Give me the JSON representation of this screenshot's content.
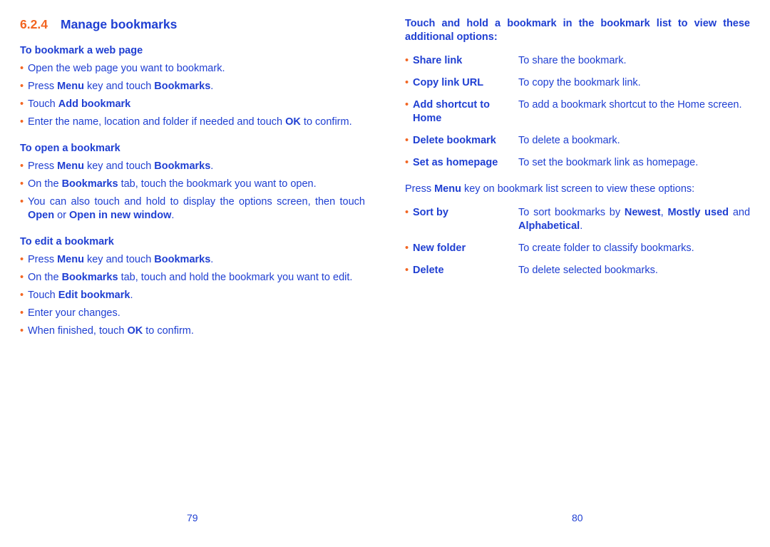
{
  "left": {
    "section_number": "6.2.4",
    "section_title": "Manage bookmarks",
    "sections": [
      {
        "heading": "To bookmark a web page",
        "bullets": [
          [
            {
              "t": "Open the web page you want to bookmark."
            }
          ],
          [
            {
              "t": "Press "
            },
            {
              "t": "Menu",
              "b": true
            },
            {
              "t": " key and touch "
            },
            {
              "t": "Bookmarks",
              "b": true
            },
            {
              "t": "."
            }
          ],
          [
            {
              "t": "Touch "
            },
            {
              "t": "Add bookmark",
              "b": true
            }
          ],
          [
            {
              "t": "Enter the name, location and folder if needed and touch "
            },
            {
              "t": "OK",
              "b": true
            },
            {
              "t": " to confirm."
            }
          ]
        ]
      },
      {
        "heading": "To open a bookmark",
        "bullets": [
          [
            {
              "t": "Press "
            },
            {
              "t": "Menu",
              "b": true
            },
            {
              "t": " key and touch "
            },
            {
              "t": "Bookmarks",
              "b": true
            },
            {
              "t": "."
            }
          ],
          [
            {
              "t": "On the "
            },
            {
              "t": "Bookmarks",
              "b": true
            },
            {
              "t": " tab, touch the bookmark you want to open."
            }
          ],
          [
            {
              "t": "You can also touch and hold to display the options screen, then touch "
            },
            {
              "t": "Open",
              "b": true
            },
            {
              "t": " or "
            },
            {
              "t": "Open in new window",
              "b": true
            },
            {
              "t": "."
            }
          ]
        ]
      },
      {
        "heading": "To edit a bookmark",
        "bullets": [
          [
            {
              "t": "Press "
            },
            {
              "t": "Menu",
              "b": true
            },
            {
              "t": " key and touch "
            },
            {
              "t": "Bookmarks",
              "b": true
            },
            {
              "t": "."
            }
          ],
          [
            {
              "t": "On the "
            },
            {
              "t": "Bookmarks",
              "b": true
            },
            {
              "t": " tab, touch and hold the bookmark you want to edit."
            }
          ],
          [
            {
              "t": "Touch "
            },
            {
              "t": "Edit bookmark",
              "b": true
            },
            {
              "t": "."
            }
          ],
          [
            {
              "t": "Enter your changes."
            }
          ],
          [
            {
              "t": "When finished, touch "
            },
            {
              "t": "OK",
              "b": true
            },
            {
              "t": " to confirm."
            }
          ]
        ]
      }
    ],
    "page_number": "79"
  },
  "right": {
    "intro": "Touch and hold a bookmark in the bookmark list to view these additional options:",
    "options": [
      {
        "key": "Share link",
        "desc": [
          {
            "t": "To share the bookmark."
          }
        ]
      },
      {
        "key": "Copy link URL",
        "desc": [
          {
            "t": "To copy the bookmark link."
          }
        ]
      },
      {
        "key": "Add shortcut to Home",
        "desc": [
          {
            "t": "To add a bookmark shortcut to the Home screen."
          }
        ]
      },
      {
        "key": "Delete bookmark",
        "desc": [
          {
            "t": "To delete a bookmark."
          }
        ]
      },
      {
        "key": "Set as homepage",
        "desc": [
          {
            "t": "To set the bookmark link as homepage."
          }
        ]
      }
    ],
    "menu_para": [
      {
        "t": "Press "
      },
      {
        "t": "Menu",
        "b": true
      },
      {
        "t": " key on bookmark list screen to view these options:"
      }
    ],
    "menu_options": [
      {
        "key": "Sort by",
        "desc": [
          {
            "t": "To sort bookmarks by "
          },
          {
            "t": "Newest",
            "b": true
          },
          {
            "t": ", "
          },
          {
            "t": "Mostly used",
            "b": true
          },
          {
            "t": " and "
          },
          {
            "t": "Alphabetical",
            "b": true
          },
          {
            "t": "."
          }
        ]
      },
      {
        "key": "New folder",
        "desc": [
          {
            "t": "To create folder to classify bookmarks."
          }
        ]
      },
      {
        "key": "Delete",
        "desc": [
          {
            "t": "To delete selected bookmarks."
          }
        ]
      }
    ],
    "page_number": "80"
  },
  "colors": {
    "text": "#1f3fd2",
    "accent": "#f26522"
  }
}
